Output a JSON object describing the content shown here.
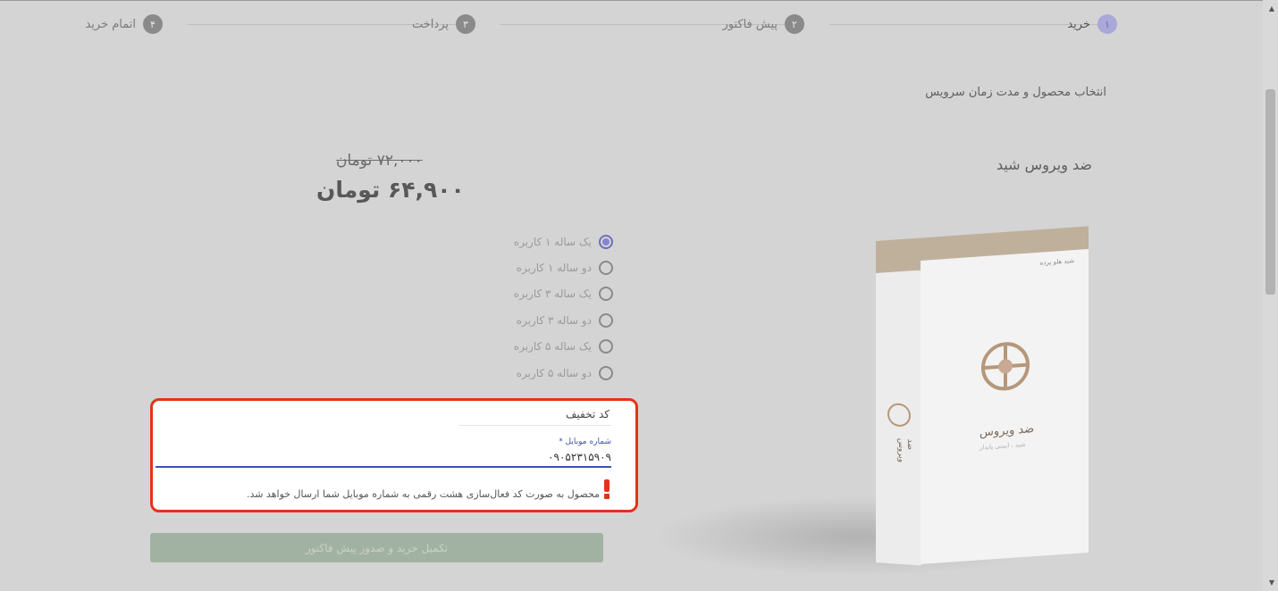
{
  "stepper": {
    "steps": [
      {
        "number": "۱",
        "label": "خرید",
        "active": true
      },
      {
        "number": "۲",
        "label": "پیش فاکتور",
        "active": false
      },
      {
        "number": "۳",
        "label": "پرداخت",
        "active": false
      },
      {
        "number": "۴",
        "label": "اتمام خرید",
        "active": false
      }
    ]
  },
  "page": {
    "heading": "انتخاب محصول و مدت زمان سرویس",
    "product_name": "ضد ویروس شید"
  },
  "product_box": {
    "brand": "شید هلو پرده",
    "title": "ضد ویروس",
    "subtitle": "شید ، ایمنی پایدار",
    "side_text": "ضد ویروس"
  },
  "price": {
    "old": "۷۲,۰۰۰ تومان",
    "new": "۶۴,۹۰۰ تومان"
  },
  "options": [
    {
      "label": "یک ساله ۱ کاربره",
      "checked": true
    },
    {
      "label": "دو ساله ۱ کاربره",
      "checked": false
    },
    {
      "label": "یک ساله ۳ کاربره",
      "checked": false
    },
    {
      "label": "دو ساله ۳ کاربره",
      "checked": false
    },
    {
      "label": "یک ساله ۵ کاربره",
      "checked": false
    },
    {
      "label": "دو ساله ۵ کاربره",
      "checked": false
    }
  ],
  "form": {
    "discount_label": "کد تخفیف",
    "mobile_label": "شماره موبایل *",
    "mobile_value": "۰۹۰۵۲۳۱۵۹۰۹",
    "info_text": "محصول به صورت کد فعال‌سازی هشت رقمی به شماره موبایل شما ارسال خواهد شد."
  },
  "submit_label": "تکمیل خرید و صدور پیش فاکتور",
  "colors": {
    "highlight_border": "#e3321a",
    "input_accent": "#3f51b5",
    "active_step": "#a9a8d8",
    "submit_bg": "#a2b2a2"
  }
}
